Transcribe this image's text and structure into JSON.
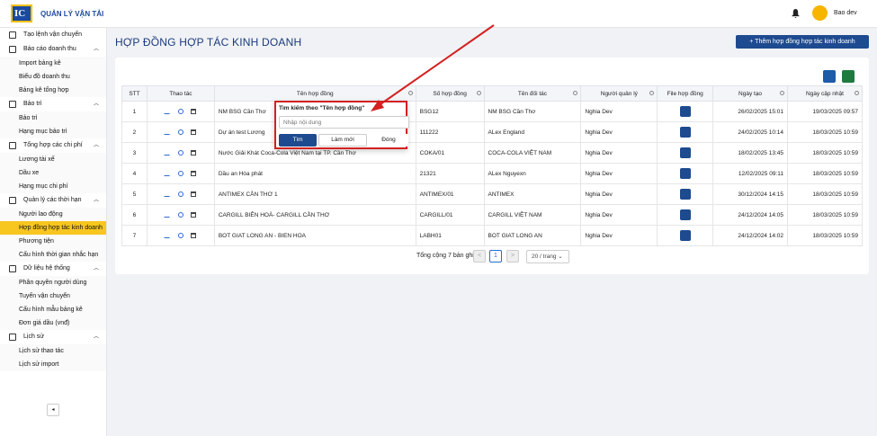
{
  "app": {
    "title": "QUẢN LÝ VẬN TẢI",
    "logo_text": "IC",
    "username": "Bao dev"
  },
  "sidebar": {
    "top_item": "Tạo lệnh vận chuyển",
    "groups": [
      {
        "label": "Báo cáo doanh thu",
        "items": [
          "Import bảng kê",
          "Biểu đồ doanh thu",
          "Bảng kê tổng hợp"
        ]
      },
      {
        "label": "Bảo trì",
        "items": [
          "Bảo trì",
          "Hạng mục bảo trì"
        ]
      },
      {
        "label": "Tổng hợp các chi phí",
        "items": [
          "Lương tài xế",
          "Dầu xe",
          "Hạng mục chi phí"
        ]
      },
      {
        "label": "Quản lý các thời hạn",
        "items": [
          "Người lao động",
          "Hợp đồng hợp tác kinh doanh",
          "Phương tiện",
          "Cấu hình thời gian nhắc hạn"
        ]
      },
      {
        "label": "Dữ liệu hệ thống",
        "items": [
          "Phân quyền người dùng",
          "Tuyến vận chuyển",
          "Cấu hình mẫu bảng kê",
          "Đơn giá dầu (vnđ)"
        ]
      },
      {
        "label": "Lịch sử",
        "items": [
          "Lịch sử thao tác",
          "Lịch sử import"
        ]
      }
    ],
    "active_item": "Hợp đồng hợp tác kinh doanh"
  },
  "page": {
    "title": "HỢP ĐỒNG HỢP TÁC KINH DOANH",
    "add_button": "+  Thêm hợp đồng hợp tác kinh doanh"
  },
  "table": {
    "headers": [
      "STT",
      "Thao tác",
      "Tên hợp đồng",
      "Số hợp đồng",
      "Tên đối tác",
      "Người quản lý",
      "File hợp đồng",
      "Ngày tạo",
      "Ngày cập nhật"
    ],
    "rows": [
      [
        "1",
        "NM BSG Cần Thơ",
        "BSG12",
        "NM BSG Cần Thơ",
        "Nghia Dev",
        "26/02/2025 15:01",
        "19/03/2025 09:57"
      ],
      [
        "2",
        "Dự án test Lương",
        "111222",
        "ALex England",
        "Nghia Dev",
        "24/02/2025 10:14",
        "18/03/2025 10:59"
      ],
      [
        "3",
        "Nước Giải Khát Coca-Cola Việt Nam tại TP. Cần Thơ",
        "COKA/01",
        "COCA-COLA VIỆT NAM",
        "Nghia Dev",
        "18/02/2025 13:45",
        "18/03/2025 10:59"
      ],
      [
        "4",
        "Dầu an Hòa phát",
        "21321",
        "ALex Nguyexn",
        "Nghia Dev",
        "12/02/2025 09:11",
        "18/03/2025 10:59"
      ],
      [
        "5",
        "ANTIMEX CẦN THƠ 1",
        "ANTIMEX/01",
        "ANTIMEX",
        "Nghia Dev",
        "30/12/2024 14:15",
        "18/03/2025 10:59"
      ],
      [
        "6",
        "CARGILL BIÊN HOÀ- CARGILL CẦN THƠ",
        "CARGILL/01",
        "CARGILL VIỆT NAM",
        "Nghia Dev",
        "24/12/2024 14:05",
        "18/03/2025 10:59"
      ],
      [
        "7",
        "BOT GIAT LONG AN - BIEN HOA",
        "LABH01",
        "BOT GIAT LONG AN",
        "Nghia Dev",
        "24/12/2024 14:02",
        "18/03/2025 10:59"
      ]
    ]
  },
  "pagination": {
    "total": "Tổng cộng 7 bản ghi",
    "prev": "<",
    "current": "1",
    "next": ">",
    "per_page": "20 / trang"
  },
  "popup": {
    "title": "Tìm kiếm theo \"Tên hợp đồng\"",
    "placeholder": "Nhập nội dung",
    "search": "Tìm",
    "reset": "Làm mới",
    "close": "Đóng"
  },
  "annotation_color": "#d42020"
}
